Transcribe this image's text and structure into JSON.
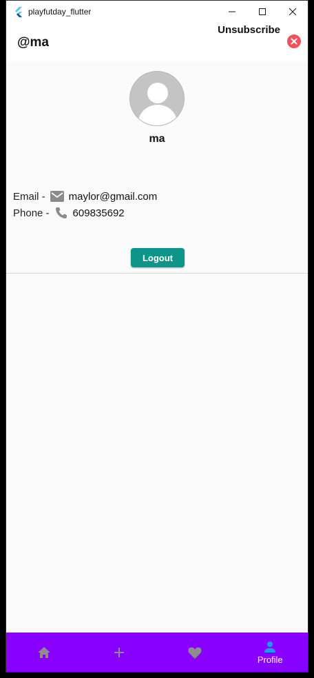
{
  "window": {
    "title": "playfutday_flutter",
    "accent": "#54c5f8"
  },
  "appbar": {
    "handle": "@ma",
    "unsubscribe_label": "Unsubscribe",
    "close_color": "#f0525b"
  },
  "profile": {
    "name": "ma",
    "email_label": "Email -",
    "email_value": "maylor@gmail.com",
    "phone_label": "Phone -",
    "phone_value": "609835692",
    "logout_label": "Logout",
    "logout_color": "#0e9488"
  },
  "bottom_nav": {
    "background": "#8800ff",
    "items": [
      {
        "icon": "home-icon",
        "label": ""
      },
      {
        "icon": "add-icon",
        "label": ""
      },
      {
        "icon": "heart-icon",
        "label": ""
      },
      {
        "icon": "person-icon",
        "label": "Profile",
        "active": true
      }
    ]
  }
}
